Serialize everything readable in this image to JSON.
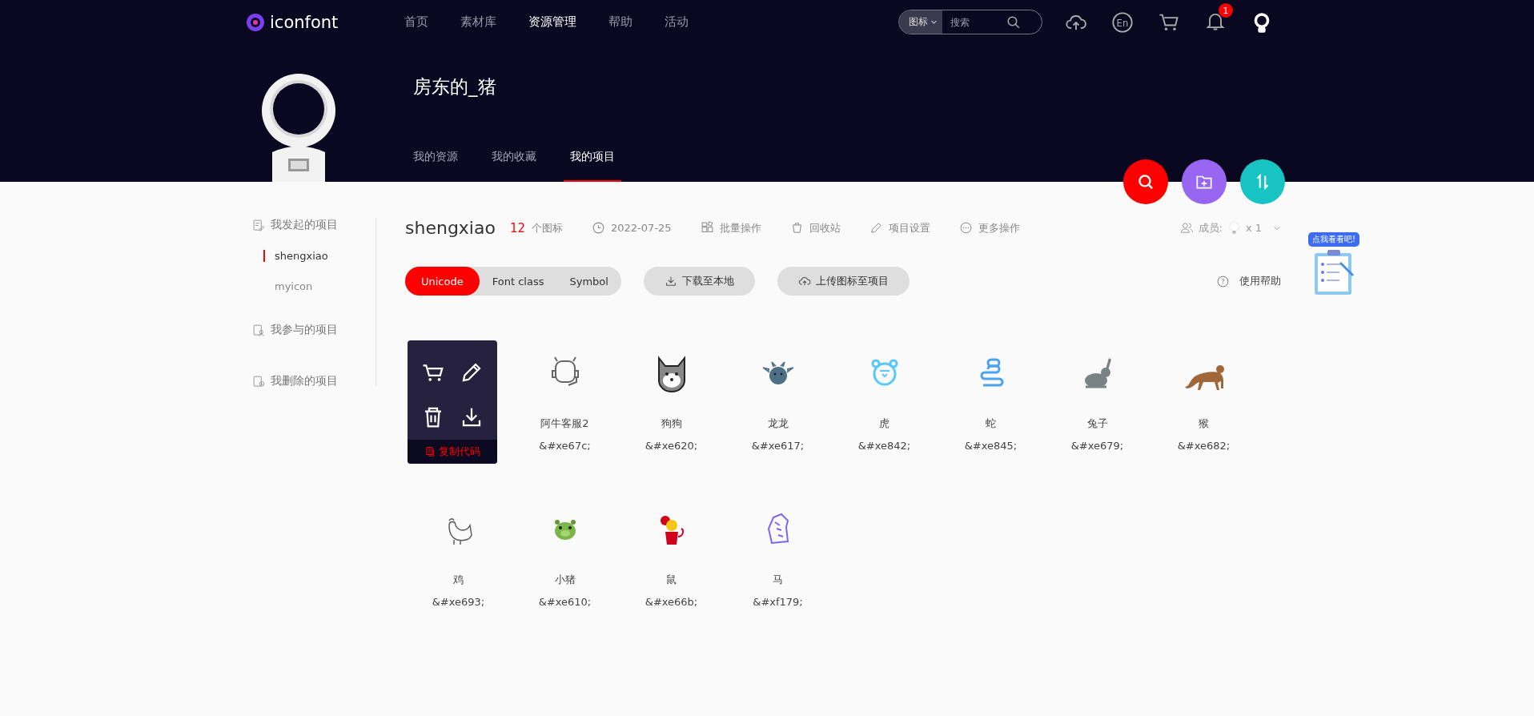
{
  "topbar": {
    "logo": "iconfont",
    "nav": [
      {
        "label": "首页",
        "selected": false
      },
      {
        "label": "素材库",
        "selected": false
      },
      {
        "label": "资源管理",
        "selected": true
      },
      {
        "label": "帮助",
        "selected": false
      },
      {
        "label": "活动",
        "selected": false
      }
    ],
    "search": {
      "scope": "图标",
      "placeholder": "搜索"
    },
    "language": "En",
    "notification_count": "1"
  },
  "profile": {
    "name": "房东的_猪",
    "tabs": [
      {
        "label": "我的资源",
        "selected": false
      },
      {
        "label": "我的收藏",
        "selected": false
      },
      {
        "label": "我的项目",
        "selected": true
      }
    ]
  },
  "sidebar": {
    "sections": [
      {
        "label": "我发起的项目",
        "children": [
          {
            "label": "shengxiao",
            "selected": true
          },
          {
            "label": "myicon",
            "selected": false
          }
        ]
      },
      {
        "label": "我参与的项目"
      },
      {
        "label": "我删除的项目"
      }
    ]
  },
  "project": {
    "name": "shengxiao",
    "count": "12",
    "count_unit": "个图标",
    "date": "2022-07-25",
    "actions": [
      "批量操作",
      "回收站",
      "项目设置",
      "更多操作"
    ],
    "members_label": "成员:",
    "members_count": "x 1",
    "formats": [
      {
        "label": "Unicode",
        "selected": true
      },
      {
        "label": "Font class",
        "selected": false
      },
      {
        "label": "Symbol",
        "selected": false
      }
    ],
    "buttons": [
      "下载至本地",
      "上传图标至项目"
    ],
    "help_mark": "?",
    "help": "使用帮助"
  },
  "promo": {
    "bubble": "点我看看吧!"
  },
  "icons": [
    {
      "hovered": true,
      "overlay_action": "复制代码"
    },
    {
      "name": "阿牛客服2",
      "code": "&#xe67c;",
      "hovered": false
    },
    {
      "name": "狗狗",
      "code": "&#xe620;",
      "hovered": false
    },
    {
      "name": "龙龙",
      "code": "&#xe617;",
      "hovered": false
    },
    {
      "name": "虎",
      "code": "&#xe842;",
      "hovered": false
    },
    {
      "name": "蛇",
      "code": "&#xe845;",
      "hovered": false
    },
    {
      "name": "兔子",
      "code": "&#xe679;",
      "hovered": false
    },
    {
      "name": "猴",
      "code": "&#xe682;",
      "hovered": false
    },
    {
      "name": "鸡",
      "code": "&#xe693;",
      "hovered": false
    },
    {
      "name": "小猪",
      "code": "&#xe610;",
      "hovered": false
    },
    {
      "name": "鼠",
      "code": "&#xe66b;",
      "hovered": false
    },
    {
      "name": "马",
      "code": "&#xf179;",
      "hovered": false
    }
  ]
}
